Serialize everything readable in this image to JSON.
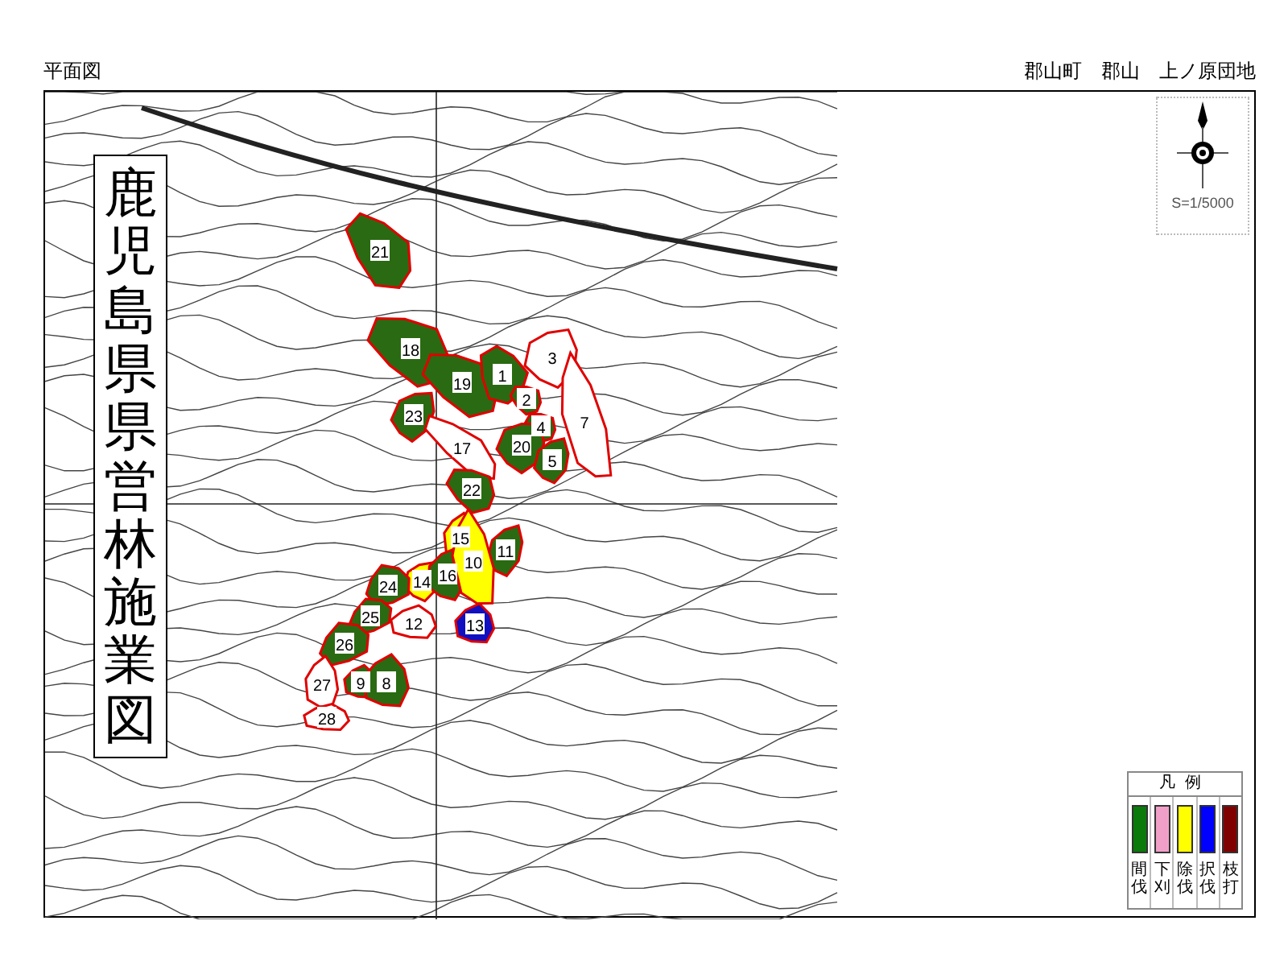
{
  "header": {
    "title": "平面図",
    "location": "郡山町　郡山　上ノ原団地"
  },
  "map": {
    "title": "鹿児島県県営林施業図",
    "scale": "S=1/5000",
    "parcels": [
      {
        "number": "21",
        "color": "#2a6a12"
      },
      {
        "number": "18",
        "color": "#2a6a12"
      },
      {
        "number": "19",
        "color": "#2a6a12"
      },
      {
        "number": "1",
        "color": "#2a6a12"
      },
      {
        "number": "3",
        "color": "#ffffff"
      },
      {
        "number": "2",
        "color": "#2a6a12"
      },
      {
        "number": "23",
        "color": "#2a6a12"
      },
      {
        "number": "4",
        "color": "#2a6a12"
      },
      {
        "number": "20",
        "color": "#2a6a12"
      },
      {
        "number": "5",
        "color": "#2a6a12"
      },
      {
        "number": "7",
        "color": "#ffffff"
      },
      {
        "number": "17",
        "color": "#ffffff"
      },
      {
        "number": "22",
        "color": "#2a6a12"
      },
      {
        "number": "15",
        "color": "#ffff00"
      },
      {
        "number": "11",
        "color": "#2a6a12"
      },
      {
        "number": "14",
        "color": "#ffff00"
      },
      {
        "number": "16",
        "color": "#2a6a12"
      },
      {
        "number": "10",
        "color": "#ffff00"
      },
      {
        "number": "24",
        "color": "#2a6a12"
      },
      {
        "number": "13",
        "color": "#1010c0"
      },
      {
        "number": "12",
        "color": "#ffffff"
      },
      {
        "number": "25",
        "color": "#2a6a12"
      },
      {
        "number": "26",
        "color": "#2a6a12"
      },
      {
        "number": "27",
        "color": "#ffffff"
      },
      {
        "number": "9",
        "color": "#2a6a12"
      },
      {
        "number": "8",
        "color": "#2a6a12"
      },
      {
        "number": "28",
        "color": "#ffffff"
      }
    ]
  },
  "legend": {
    "title": "凡例",
    "items": [
      {
        "label": "間伐",
        "color": "#0a7a0a"
      },
      {
        "label": "下刈",
        "color": "#f0a0c8"
      },
      {
        "label": "除伐",
        "color": "#ffff00"
      },
      {
        "label": "択伐",
        "color": "#0000ff"
      },
      {
        "label": "枝打",
        "color": "#800000"
      }
    ]
  }
}
